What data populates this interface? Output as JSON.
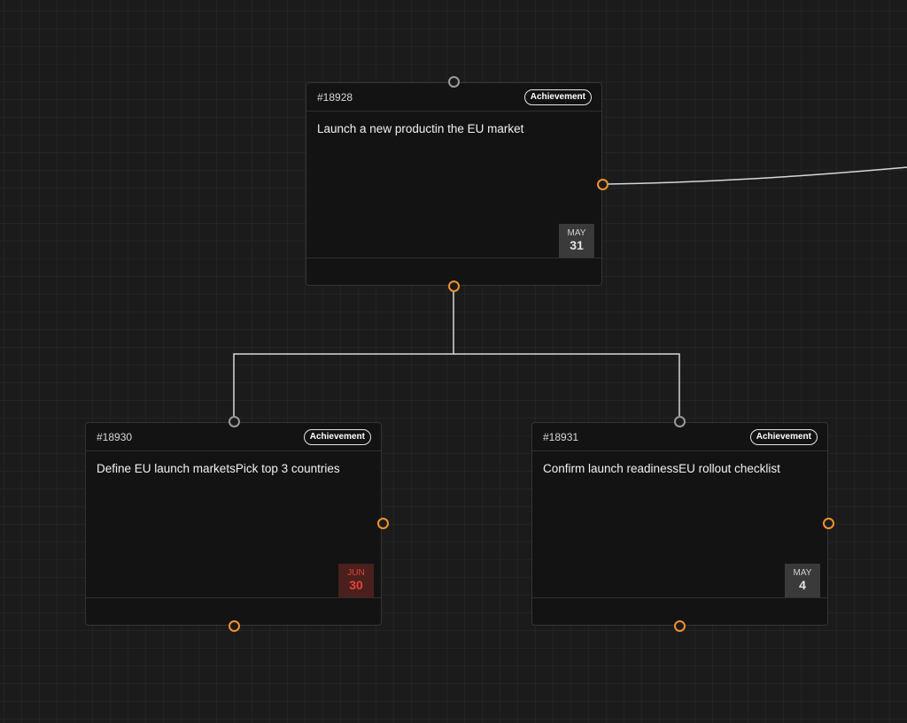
{
  "colors": {
    "canvas": "#1b1b1b",
    "card": "#131313",
    "accent": "#f0922b",
    "overdue": "#e8433a",
    "edge": "#d8d8d8"
  },
  "cards": [
    {
      "id": "#18928",
      "badge": "Achievement",
      "title": "Launch a new productin the EU market",
      "date": {
        "month": "MAY",
        "day": "31",
        "overdue": false
      }
    },
    {
      "id": "#18930",
      "badge": "Achievement",
      "title": "Define EU launch marketsPick top 3 countries",
      "date": {
        "month": "JUN",
        "day": "30",
        "overdue": true
      }
    },
    {
      "id": "#18931",
      "badge": "Achievement",
      "title": "Confirm launch readinessEU rollout checklist",
      "date": {
        "month": "MAY",
        "day": "4",
        "overdue": false
      }
    }
  ]
}
